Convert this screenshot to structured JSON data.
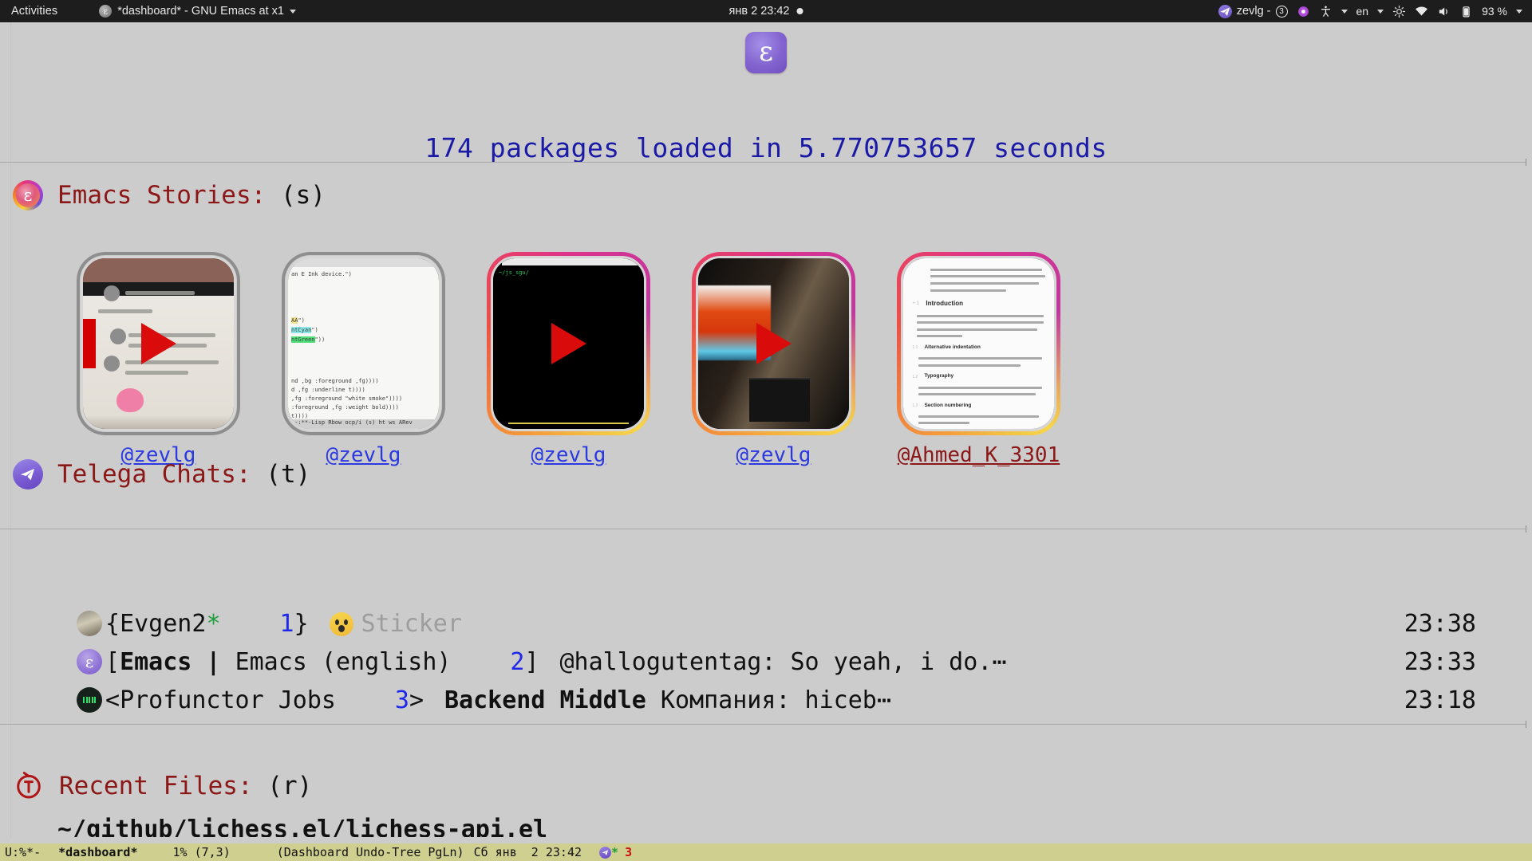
{
  "topbar": {
    "activities": "Activities",
    "window_title": "*dashboard* - GNU Emacs at x1",
    "clock": "янв 2  23:42",
    "telegram_account": "zevlg -",
    "telegram_badge": "3",
    "language": "en",
    "battery": "93 %",
    "icons": [
      "emacs-icon",
      "chevron-down-icon",
      "notification-dot",
      "telegram-icon",
      "accessibility-icon",
      "chevron-down-icon",
      "brightness-icon",
      "wifi-icon",
      "volume-icon",
      "battery-icon",
      "chevron-down-icon"
    ]
  },
  "banner": {
    "logo": "emacs-logo",
    "text": "174 packages loaded in 5.770753657 seconds"
  },
  "stories": {
    "icon": "emacs-stories-icon",
    "title": "Emacs Stories: ",
    "key": "(s)",
    "items": [
      {
        "author": "@zevlg",
        "seen": true,
        "kind": "video",
        "art": "t1",
        "author_color": "blue"
      },
      {
        "author": "@zevlg",
        "seen": true,
        "kind": "image",
        "art": "t2",
        "author_color": "blue"
      },
      {
        "author": "@zevlg",
        "seen": false,
        "kind": "video",
        "art": "t3",
        "author_color": "blue"
      },
      {
        "author": "@zevlg",
        "seen": false,
        "kind": "video",
        "art": "t4",
        "author_color": "blue"
      },
      {
        "author": "@Ahmed_K_3301",
        "seen": false,
        "kind": "image",
        "art": "t5",
        "author_color": "red"
      }
    ]
  },
  "telega": {
    "icon": "telegram-icon",
    "title": "Telega Chats: ",
    "key": "(t)",
    "chats": [
      {
        "avatar": "evgen-avatar",
        "open_bracket": "{",
        "name": "Evgen2",
        "marker": "*",
        "index": "1",
        "close_bracket": "}",
        "message": "Sticker",
        "message_muted": true,
        "message_bold": "",
        "emoji": "astonished-face",
        "time": "23:38"
      },
      {
        "avatar": "emacs-avatar",
        "open_bracket": "[",
        "name": "Emacs",
        "name_bold": true,
        "separator": " | ",
        "subtitle": "Emacs (english)",
        "index": "2",
        "close_bracket": "]",
        "message": "@hallogutentag: So yeah, i do.⋯",
        "message_muted": false,
        "message_bold": "",
        "emoji": "",
        "time": "23:33"
      },
      {
        "avatar": "profunctor-avatar",
        "open_bracket": "<",
        "name": "Profunctor Jobs",
        "index": "3",
        "close_bracket": ">",
        "message": " Компания: hiceb⋯",
        "message_muted": false,
        "message_bold": "Backend Middle",
        "emoji": "",
        "time": "23:18"
      }
    ]
  },
  "recent": {
    "icon": "recent-files-icon",
    "title": "Recent Files: ",
    "key": "(r)",
    "files": [
      "~/github/lichess.el/lichess-api.el"
    ]
  },
  "modeline": {
    "status": "U:%*-",
    "buffer": "*dashboard*",
    "position": "1% (7,3)",
    "modes": "(Dashboard Undo-Tree PgLn)",
    "date": "Сб янв  2 23:42",
    "telegram_star": "*",
    "telegram_count": "3"
  }
}
